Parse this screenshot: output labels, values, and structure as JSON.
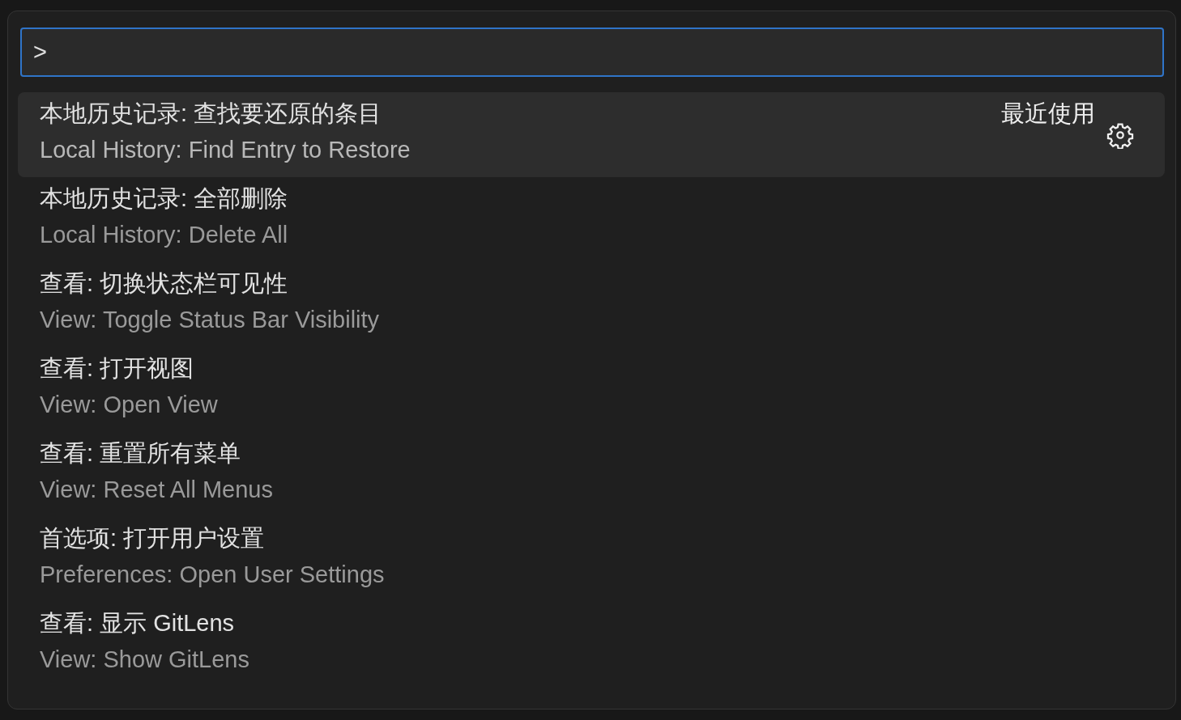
{
  "command_palette": {
    "input": {
      "value": ">"
    },
    "items": [
      {
        "label": "本地历史记录: 查找要还原的条目",
        "detail": "Local History: Find Entry to Restore",
        "badge": "最近使用",
        "selected": true
      },
      {
        "label": "本地历史记录: 全部删除",
        "detail": "Local History: Delete All",
        "selected": false
      },
      {
        "label": "查看: 切换状态栏可见性",
        "detail": "View: Toggle Status Bar Visibility",
        "selected": false
      },
      {
        "label": "查看: 打开视图",
        "detail": "View: Open View",
        "selected": false
      },
      {
        "label": "查看: 重置所有菜单",
        "detail": "View: Reset All Menus",
        "selected": false
      },
      {
        "label": "首选项: 打开用户设置",
        "detail": "Preferences: Open User Settings",
        "selected": false
      },
      {
        "label": "查看: 显示 GitLens",
        "detail": "View: Show GitLens",
        "selected": false
      }
    ]
  }
}
